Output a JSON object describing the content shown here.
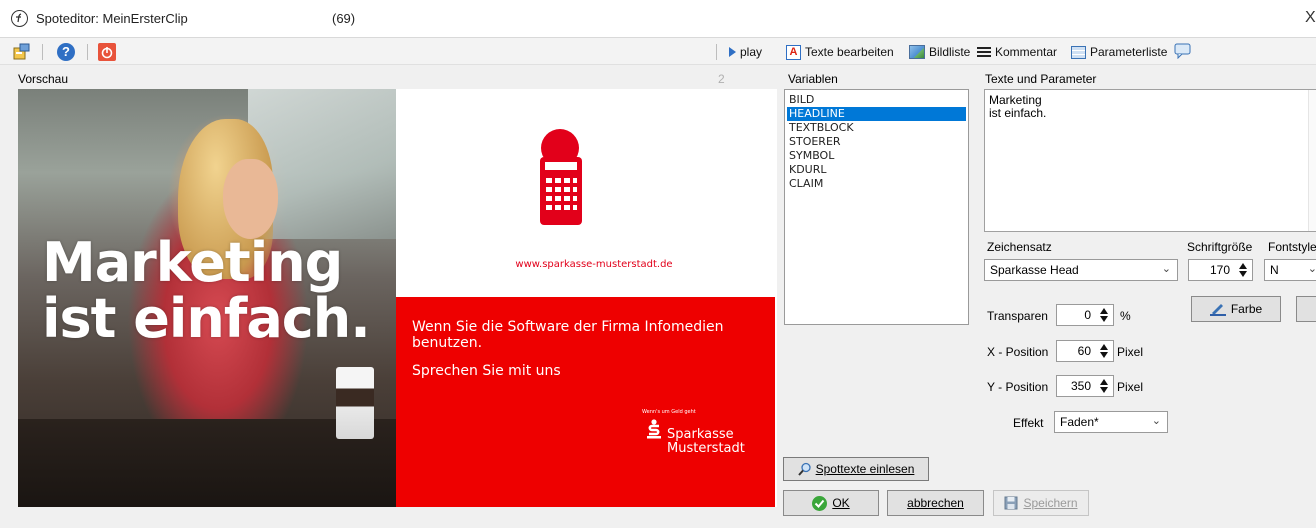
{
  "window": {
    "title": "Spoteditor: MeinErsterClip",
    "count": "(69)",
    "close": "X"
  },
  "toolbar": {
    "play": "play",
    "edit_texts": "Texte bearbeiten",
    "image_list": "Bildliste",
    "comment": "Kommentar",
    "param_list": "Parameterliste"
  },
  "preview": {
    "label": "Vorschau",
    "number": "2",
    "headline_lines": [
      "Marketing",
      "ist einfach."
    ],
    "website": "www.sparkasse-musterstadt.de",
    "red_text_1": "Wenn Sie die Software der Firma Infomedien benutzen.",
    "red_text_2": "Sprechen Sie mit uns",
    "slogan_small": "Wenn's um Geld geht",
    "brand_line1": "Sparkasse",
    "brand_line2": "Musterstadt",
    "colors": {
      "brand_red": "#ee0000"
    }
  },
  "variables": {
    "label": "Variablen",
    "items": [
      "BILD",
      "HEADLINE",
      "TEXTBLOCK",
      "STOERER",
      "SYMBOL",
      "KDURL",
      "CLAIM"
    ],
    "selected": "HEADLINE",
    "read_button": "Spottexte einlesen"
  },
  "texts": {
    "label": "Texte und Parameter",
    "content_line1": "Marketing",
    "content_line2": "ist einfach.",
    "font_label": "Zeichensatz",
    "font_value": "Sparkasse Head",
    "size_label": "Schriftgröße",
    "size_value": "170",
    "style_label": "Fontstyle",
    "style_value": "N",
    "color_button": "Farbe",
    "transparency_label": "Transparen",
    "transparency_value": "0",
    "transparency_unit": "%",
    "x_label": "X - Position",
    "x_value": "60",
    "y_label": "Y - Position",
    "y_value": "350",
    "pixel_unit": "Pixel",
    "effect_label": "Effekt",
    "effect_value": "Faden*"
  },
  "footer": {
    "ok": "OK",
    "cancel": "abbrechen",
    "save": "Speichern"
  }
}
